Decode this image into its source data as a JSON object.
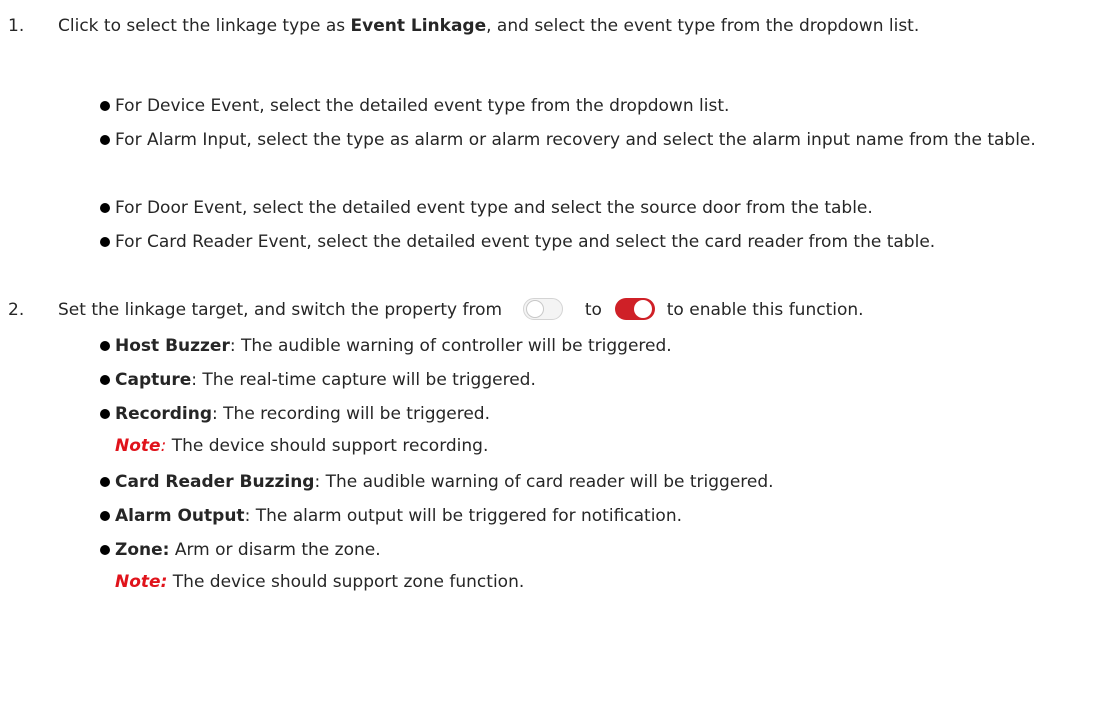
{
  "steps": [
    {
      "number": "1.",
      "pre": "Click to select the linkage type as ",
      "bold": "Event Linkage",
      "post": ", and select the event type from the dropdown list.",
      "bullets": [
        "For Device Event, select the detailed event type from the dropdown list.",
        "For Alarm Input, select the type as alarm or alarm recovery and select the alarm input name from the table.",
        "For Door Event, select the detailed event type and select the source door from the table.",
        "For Card Reader Event, select the detailed event type and select the card reader from the table."
      ]
    },
    {
      "number": "2.",
      "pre": "Set the linkage target, and switch the property from",
      "mid": "to",
      "post": "to enable this function.",
      "toggle_off_color": "#f4f4f4",
      "toggle_on_color": "#cf2027",
      "bullets": [
        {
          "label": "Host Buzzer",
          "text": ": The audible warning of controller will be triggered."
        },
        {
          "label": "Capture",
          "text": ": The real-time capture will be triggered."
        },
        {
          "label": "Recording",
          "text": ": The recording will be triggered."
        },
        {
          "label": "Card Reader Buzzing",
          "text": ": The audible warning of card reader will be triggered."
        },
        {
          "label": "Alarm Output",
          "text": ": The alarm output will be triggered for notification."
        },
        {
          "label": "Zone:",
          "text": " Arm or disarm the zone."
        }
      ],
      "notes": [
        {
          "label": "Note",
          "sep": ":",
          "text": " The device should support recording."
        },
        {
          "label": "Note:",
          "text": " The device should support zone function."
        }
      ]
    }
  ],
  "note_color": "#e0131b"
}
